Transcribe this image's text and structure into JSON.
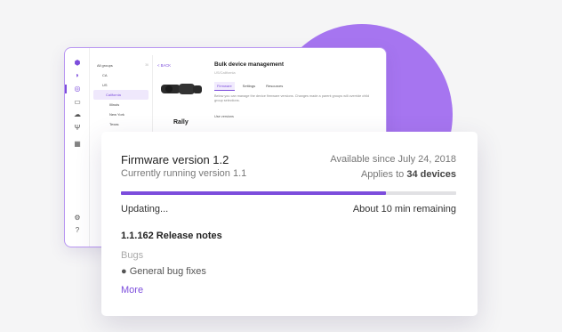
{
  "colors": {
    "accent": "#7c4ddc",
    "circle": "#a675f0"
  },
  "app": {
    "rail_icons": [
      "logo-icon",
      "device-icon",
      "group-icon",
      "book-icon",
      "cloud-icon",
      "antenna-icon",
      "grid-icon",
      "settings-icon",
      "help-icon"
    ],
    "tree": [
      {
        "label": "All groups",
        "count": "36"
      },
      {
        "label": "CA",
        "count": ""
      },
      {
        "label": "US",
        "count": ""
      },
      {
        "label": "California",
        "count": ""
      },
      {
        "label": "Illinois",
        "count": ""
      },
      {
        "label": "New York",
        "count": ""
      },
      {
        "label": "Texas",
        "count": ""
      }
    ],
    "back_label": "< BACK",
    "device_name": "Rally",
    "pane_title": "Bulk device management",
    "pane_subtitle": "US/California",
    "tabs": [
      "Firmware",
      "Settings",
      "Resources"
    ],
    "description": "Below you can manage the device firmware versions. Changes made a parent groups will override child group selections.",
    "link": "Use versions"
  },
  "card": {
    "title": "Firmware version 1.2",
    "running": "Currently running version 1.1",
    "available": "Available since July 24, 2018",
    "applies_prefix": "Applies to",
    "applies_count": "34 devices",
    "progress": 0.79,
    "status": "Updating...",
    "remaining": "About 10 min remaining",
    "notes_title": "1.1.162 Release notes",
    "notes_section": "Bugs",
    "notes_item": "General bug fixes",
    "more": "More"
  }
}
